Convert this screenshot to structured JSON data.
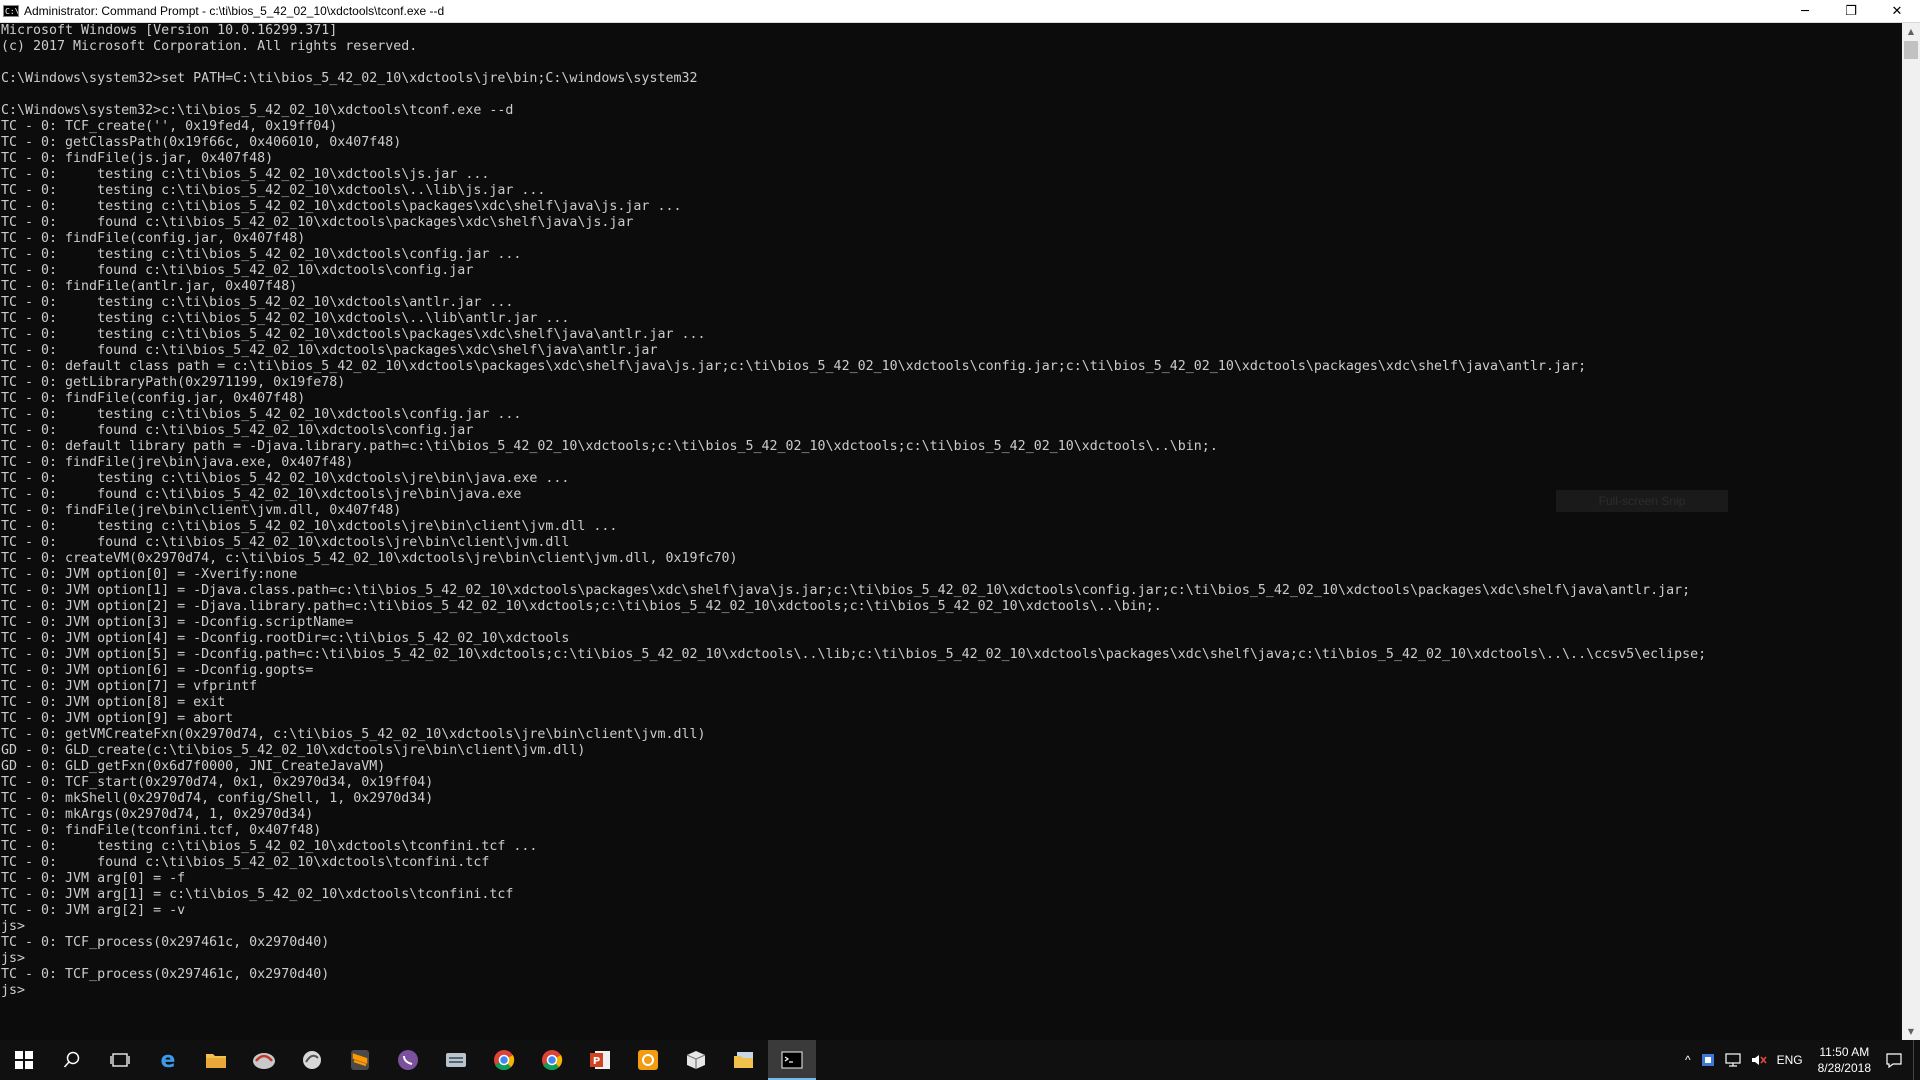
{
  "window": {
    "title": "Administrator: Command Prompt - c:\\ti\\bios_5_42_02_10\\xdctools\\tconf.exe  --d",
    "icon_text": "C:\\",
    "minimize_glyph": "─",
    "maximize_glyph": "❐",
    "close_glyph": "✕"
  },
  "console": {
    "lines": [
      "Microsoft Windows [Version 10.0.16299.371]",
      "(c) 2017 Microsoft Corporation. All rights reserved.",
      "",
      "C:\\Windows\\system32>set PATH=C:\\ti\\bios_5_42_02_10\\xdctools\\jre\\bin;C:\\windows\\system32",
      "",
      "C:\\Windows\\system32>c:\\ti\\bios_5_42_02_10\\xdctools\\tconf.exe --d",
      "TC - 0: TCF_create('', 0x19fed4, 0x19ff04)",
      "TC - 0: getClassPath(0x19f66c, 0x406010, 0x407f48)",
      "TC - 0: findFile(js.jar, 0x407f48)",
      "TC - 0:     testing c:\\ti\\bios_5_42_02_10\\xdctools\\js.jar ...",
      "TC - 0:     testing c:\\ti\\bios_5_42_02_10\\xdctools\\..\\lib\\js.jar ...",
      "TC - 0:     testing c:\\ti\\bios_5_42_02_10\\xdctools\\packages\\xdc\\shelf\\java\\js.jar ...",
      "TC - 0:     found c:\\ti\\bios_5_42_02_10\\xdctools\\packages\\xdc\\shelf\\java\\js.jar",
      "TC - 0: findFile(config.jar, 0x407f48)",
      "TC - 0:     testing c:\\ti\\bios_5_42_02_10\\xdctools\\config.jar ...",
      "TC - 0:     found c:\\ti\\bios_5_42_02_10\\xdctools\\config.jar",
      "TC - 0: findFile(antlr.jar, 0x407f48)",
      "TC - 0:     testing c:\\ti\\bios_5_42_02_10\\xdctools\\antlr.jar ...",
      "TC - 0:     testing c:\\ti\\bios_5_42_02_10\\xdctools\\..\\lib\\antlr.jar ...",
      "TC - 0:     testing c:\\ti\\bios_5_42_02_10\\xdctools\\packages\\xdc\\shelf\\java\\antlr.jar ...",
      "TC - 0:     found c:\\ti\\bios_5_42_02_10\\xdctools\\packages\\xdc\\shelf\\java\\antlr.jar",
      "TC - 0: default class path = c:\\ti\\bios_5_42_02_10\\xdctools\\packages\\xdc\\shelf\\java\\js.jar;c:\\ti\\bios_5_42_02_10\\xdctools\\config.jar;c:\\ti\\bios_5_42_02_10\\xdctools\\packages\\xdc\\shelf\\java\\antlr.jar;",
      "TC - 0: getLibraryPath(0x2971199, 0x19fe78)",
      "TC - 0: findFile(config.jar, 0x407f48)",
      "TC - 0:     testing c:\\ti\\bios_5_42_02_10\\xdctools\\config.jar ...",
      "TC - 0:     found c:\\ti\\bios_5_42_02_10\\xdctools\\config.jar",
      "TC - 0: default library path = -Djava.library.path=c:\\ti\\bios_5_42_02_10\\xdctools;c:\\ti\\bios_5_42_02_10\\xdctools;c:\\ti\\bios_5_42_02_10\\xdctools\\..\\bin;.",
      "TC - 0: findFile(jre\\bin\\java.exe, 0x407f48)",
      "TC - 0:     testing c:\\ti\\bios_5_42_02_10\\xdctools\\jre\\bin\\java.exe ...",
      "TC - 0:     found c:\\ti\\bios_5_42_02_10\\xdctools\\jre\\bin\\java.exe",
      "TC - 0: findFile(jre\\bin\\client\\jvm.dll, 0x407f48)",
      "TC - 0:     testing c:\\ti\\bios_5_42_02_10\\xdctools\\jre\\bin\\client\\jvm.dll ...",
      "TC - 0:     found c:\\ti\\bios_5_42_02_10\\xdctools\\jre\\bin\\client\\jvm.dll",
      "TC - 0: createVM(0x2970d74, c:\\ti\\bios_5_42_02_10\\xdctools\\jre\\bin\\client\\jvm.dll, 0x19fc70)",
      "TC - 0: JVM option[0] = -Xverify:none",
      "TC - 0: JVM option[1] = -Djava.class.path=c:\\ti\\bios_5_42_02_10\\xdctools\\packages\\xdc\\shelf\\java\\js.jar;c:\\ti\\bios_5_42_02_10\\xdctools\\config.jar;c:\\ti\\bios_5_42_02_10\\xdctools\\packages\\xdc\\shelf\\java\\antlr.jar;",
      "TC - 0: JVM option[2] = -Djava.library.path=c:\\ti\\bios_5_42_02_10\\xdctools;c:\\ti\\bios_5_42_02_10\\xdctools;c:\\ti\\bios_5_42_02_10\\xdctools\\..\\bin;.",
      "TC - 0: JVM option[3] = -Dconfig.scriptName=",
      "TC - 0: JVM option[4] = -Dconfig.rootDir=c:\\ti\\bios_5_42_02_10\\xdctools",
      "TC - 0: JVM option[5] = -Dconfig.path=c:\\ti\\bios_5_42_02_10\\xdctools;c:\\ti\\bios_5_42_02_10\\xdctools\\..\\lib;c:\\ti\\bios_5_42_02_10\\xdctools\\packages\\xdc\\shelf\\java;c:\\ti\\bios_5_42_02_10\\xdctools\\..\\..\\ccsv5\\eclipse;",
      "TC - 0: JVM option[6] = -Dconfig.gopts=",
      "TC - 0: JVM option[7] = vfprintf",
      "TC - 0: JVM option[8] = exit",
      "TC - 0: JVM option[9] = abort",
      "TC - 0: getVMCreateFxn(0x2970d74, c:\\ti\\bios_5_42_02_10\\xdctools\\jre\\bin\\client\\jvm.dll)",
      "GD - 0: GLD_create(c:\\ti\\bios_5_42_02_10\\xdctools\\jre\\bin\\client\\jvm.dll)",
      "GD - 0: GLD_getFxn(0x6d7f0000, JNI_CreateJavaVM)",
      "TC - 0: TCF_start(0x2970d74, 0x1, 0x2970d34, 0x19ff04)",
      "TC - 0: mkShell(0x2970d74, config/Shell, 1, 0x2970d34)",
      "TC - 0: mkArgs(0x2970d74, 1, 0x2970d34)",
      "TC - 0: findFile(tconfini.tcf, 0x407f48)",
      "TC - 0:     testing c:\\ti\\bios_5_42_02_10\\xdctools\\tconfini.tcf ...",
      "TC - 0:     found c:\\ti\\bios_5_42_02_10\\xdctools\\tconfini.tcf",
      "TC - 0: JVM arg[0] = -f",
      "TC - 0: JVM arg[1] = c:\\ti\\bios_5_42_02_10\\xdctools\\tconfini.tcf",
      "TC - 0: JVM arg[2] = -v",
      "js>",
      "TC - 0: TCF_process(0x297461c, 0x2970d40)",
      "js>",
      "TC - 0: TCF_process(0x297461c, 0x2970d40)",
      "js>"
    ]
  },
  "overlay": {
    "snip_tooltip": "Full-screen Snip"
  },
  "taskbar": {
    "apps": [
      {
        "name": "start-button",
        "icon": "windows-logo-icon",
        "active": false
      },
      {
        "name": "search-button",
        "icon": "search-icon",
        "active": false
      },
      {
        "name": "task-view-button",
        "icon": "task-view-icon",
        "active": false
      },
      {
        "name": "taskbar-edge",
        "icon": "edge-icon",
        "active": false
      },
      {
        "name": "taskbar-file-explorer",
        "icon": "folder-icon",
        "active": false
      },
      {
        "name": "taskbar-app-6",
        "icon": "app-swirl-icon",
        "active": false
      },
      {
        "name": "taskbar-app-7",
        "icon": "app-bird-icon",
        "active": false
      },
      {
        "name": "taskbar-sublime",
        "icon": "sublime-icon",
        "active": false
      },
      {
        "name": "taskbar-viber",
        "icon": "viber-icon",
        "active": false
      },
      {
        "name": "taskbar-app-10",
        "icon": "app-keyboard-icon",
        "active": false
      },
      {
        "name": "taskbar-chrome-1",
        "icon": "chrome-icon",
        "active": false
      },
      {
        "name": "taskbar-chrome-2",
        "icon": "chrome-icon",
        "active": false
      },
      {
        "name": "taskbar-powerpoint",
        "icon": "powerpoint-icon",
        "active": false
      },
      {
        "name": "taskbar-app-14",
        "icon": "app-orange-icon",
        "active": false
      },
      {
        "name": "taskbar-app-15",
        "icon": "cube-icon",
        "active": false
      },
      {
        "name": "taskbar-app-16",
        "icon": "folder-stack-icon",
        "active": false
      },
      {
        "name": "taskbar-cmd",
        "icon": "cmd-icon",
        "active": true
      }
    ],
    "tray": {
      "chevron": "^",
      "language": "ENG",
      "time": "11:50 AM",
      "date": "8/28/2018"
    }
  },
  "colors": {
    "console_bg": "#0c0c0c",
    "console_fg": "#cccccc",
    "taskbar_bg": "#101010",
    "active_accent": "#76b9ed"
  }
}
